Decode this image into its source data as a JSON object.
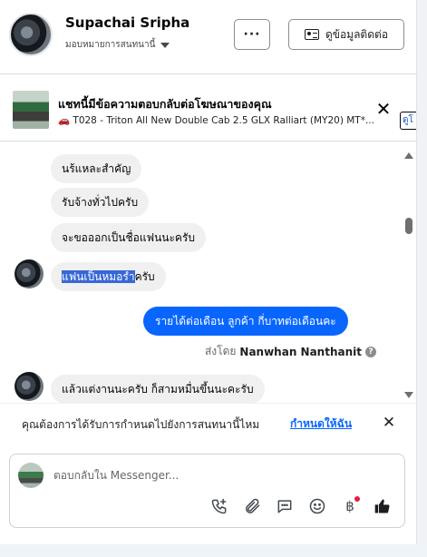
{
  "header": {
    "contact_name": "Supachai Sripha",
    "assign_label": "มอบหมายการสนทนานี้",
    "more_label": "···",
    "contact_info_label": "ดูข้อมูลติดต่อ"
  },
  "ad_banner": {
    "title": "แชทนี้มีข้อความตอบกลับต่อโฆษณาของคุณ",
    "subtitle": "🚗 T028 - Triton All New Double Cab 2.5 GLX Ralliart (MY20) MT*...",
    "close_label": "✕",
    "tag_label": "ดูโ"
  },
  "messages": [
    {
      "text": "นร้แหละสำคัญ",
      "direction": "in"
    },
    {
      "text": "รับจ้างทั่วไปครับ",
      "direction": "in"
    },
    {
      "text": "จะขอออกเป็นชื่อแฟนนะครับ",
      "direction": "in"
    },
    {
      "text_selected": "แฟนเป็นหมอรำ",
      "text_rest": "ครับ",
      "direction": "in"
    },
    {
      "text": "รายได้ต่อเดือน ลูกค้า กี่บาทต่อเดือนคะ",
      "direction": "out"
    },
    {
      "text": "แล้วแต่งานนะครับ ก็สามหมื่นขึ้นนะคะรับ",
      "direction": "in"
    }
  ],
  "sent_by": {
    "prefix": "ส่งโดย",
    "name": "Nanwhan Nanthanit",
    "info": "?"
  },
  "assign_prompt": {
    "question": "คุณต้องการได้รับการกำหนดไปยังการสนทนานี้ไหม",
    "link": "กำหนดให้ฉัน",
    "close_label": "✕"
  },
  "composer": {
    "placeholder": "ตอบกลับใน Messenger...",
    "tools": [
      "phone-plus-icon",
      "paperclip-icon",
      "chat-bubble-icon",
      "smiley-icon",
      "baht-icon",
      "thumbs-up-icon"
    ],
    "baht_label": "฿"
  },
  "colors": {
    "accent": "#0866ff",
    "selection": "#3867d6",
    "bubble_in": "#f0f0f0",
    "badge": "#e41e3f"
  }
}
